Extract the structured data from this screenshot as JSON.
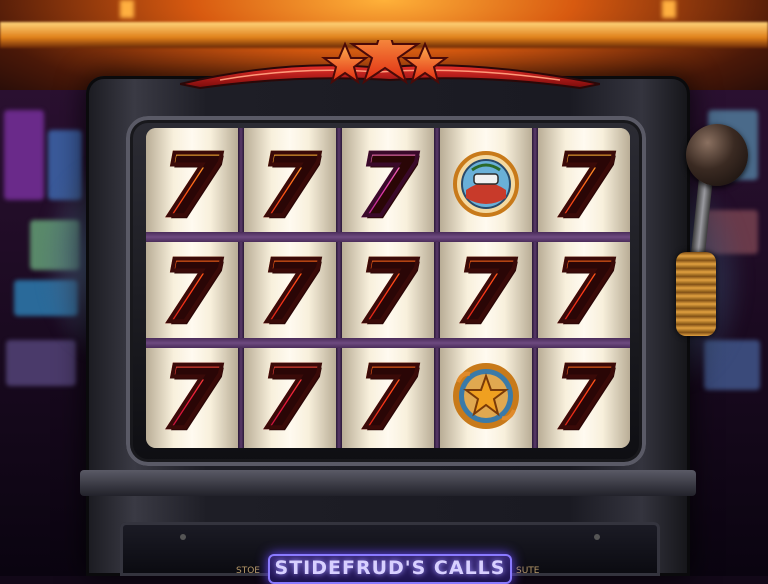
{
  "game": {
    "marquee_text": "STIDEFRUD'S CALLS",
    "side_label_left": "STOE",
    "side_label_right": "SUTE"
  },
  "reels": [
    [
      "7",
      "7",
      "7"
    ],
    [
      "7",
      "7",
      "7"
    ],
    [
      "7",
      "7",
      "7"
    ],
    [
      "badge-emblem-icon",
      "7",
      "star-emblem-icon"
    ],
    [
      "7",
      "7",
      "7"
    ]
  ],
  "reel_colors": [
    [
      "orange",
      "red",
      "crimson"
    ],
    [
      "orange",
      "red",
      "crimson"
    ],
    [
      "pink",
      "red",
      "red"
    ],
    [
      "emblem",
      "red",
      "emblem"
    ],
    [
      "orange",
      "red",
      "red"
    ]
  ],
  "colors": {
    "ceiling_glow": "#ff9a2a",
    "marquee_bg": "#2a1a6a",
    "reel_band": "#5a3a6a"
  }
}
